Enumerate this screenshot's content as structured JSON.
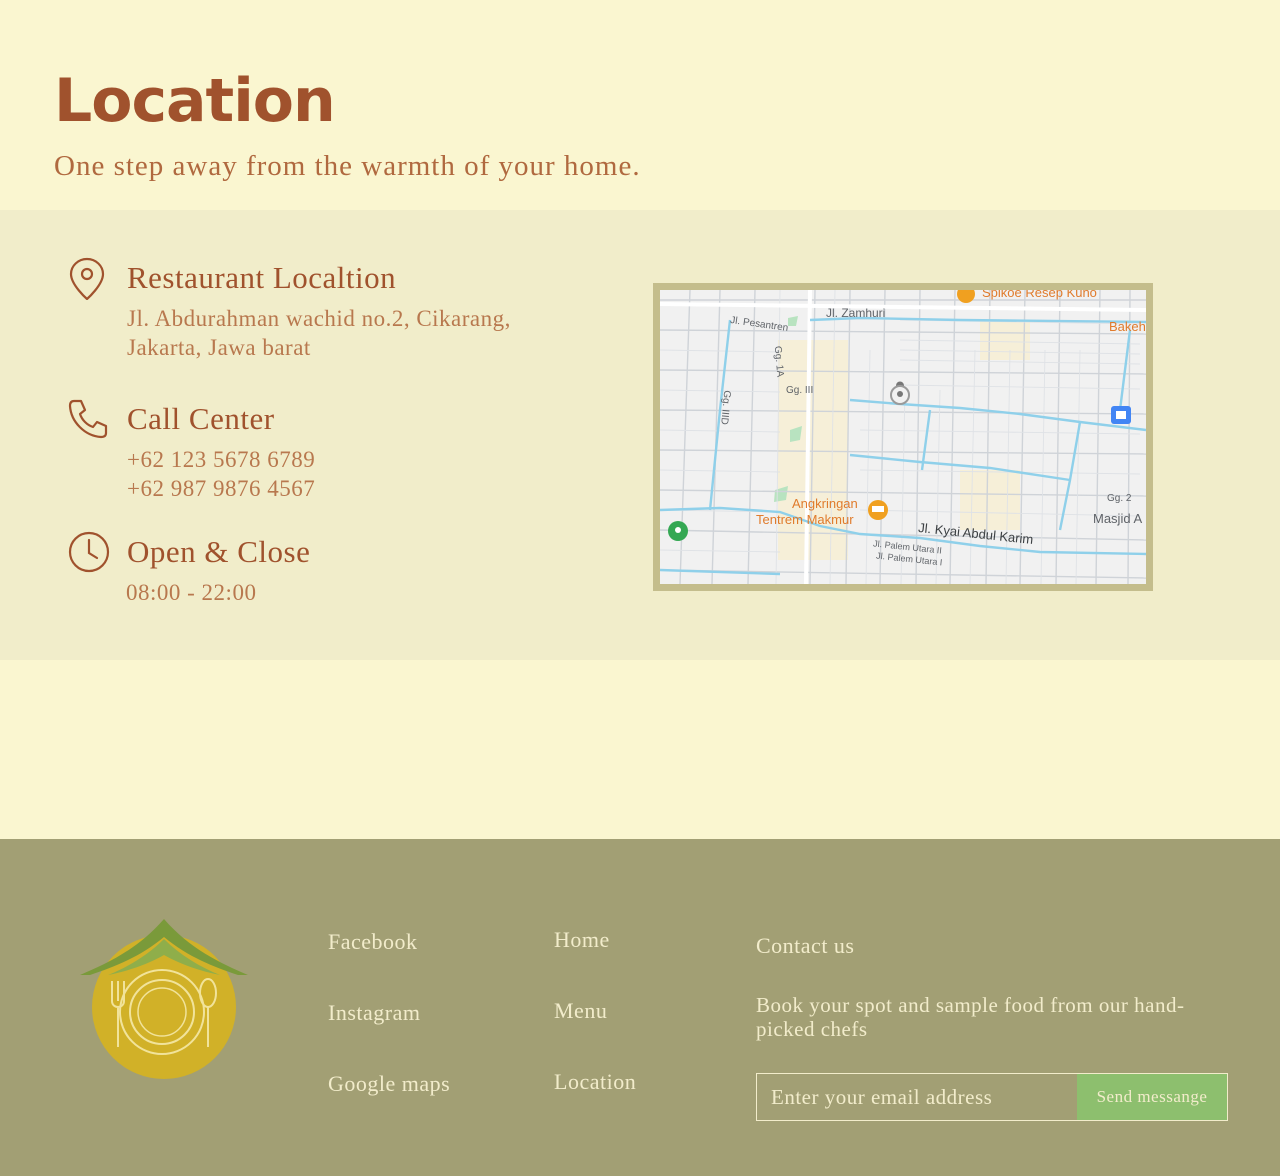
{
  "hero": {
    "title": "Location",
    "subtitle": "One step away from the warmth of your home."
  },
  "info": {
    "restaurant": {
      "icon": "map-pin-icon",
      "title": "Restaurant Localtion",
      "lines": [
        "Jl. Abdurahman wachid no.2, Cikarang,",
        "Jakarta, Jawa barat"
      ]
    },
    "call_center": {
      "icon": "phone-icon",
      "title": "Call Center",
      "lines": [
        "+62 123 5678 6789",
        "+62 987 9876 4567"
      ]
    },
    "hours": {
      "icon": "clock-icon",
      "title": "Open & Close",
      "lines": [
        "08:00 - 22:00"
      ]
    }
  },
  "map": {
    "labels": {
      "spikoe": "Spikoe Resep Kuno",
      "bakeh": "Bakeh",
      "zamhuri": "Jl. Zamhuri",
      "pesantren": "Jl. Pesantren",
      "gg1a": "Gg. 1A",
      "gg3": "Gg. III",
      "gg3d": "Gg. IIID",
      "angkringan1": "Angkringan",
      "angkringan2": "Tentrem Makmur",
      "kyai": "Jl. Kyai Abdul Karim",
      "palem1": "Jl. Palem Utara II",
      "palem2": "Jl. Palem Utara I",
      "masjid": "Masjid A",
      "gg2": "Gg. 2"
    }
  },
  "footer": {
    "social": [
      "Facebook",
      "Instagram",
      "Google maps"
    ],
    "nav": [
      "Home",
      "Menu",
      "Location"
    ],
    "contact": {
      "title": "Contact us",
      "description": "Book your spot and sample food from our hand-picked chefs",
      "email_placeholder": "Enter your email address",
      "button": "Send messange"
    }
  },
  "colors": {
    "background": "#faf6d0",
    "info_band": "#f1edca",
    "accent": "#a0522d",
    "footer": "#a29f74",
    "button": "#8dbf6e",
    "logo_gold": "#d1b128",
    "logo_green": "#7a9a3a"
  }
}
